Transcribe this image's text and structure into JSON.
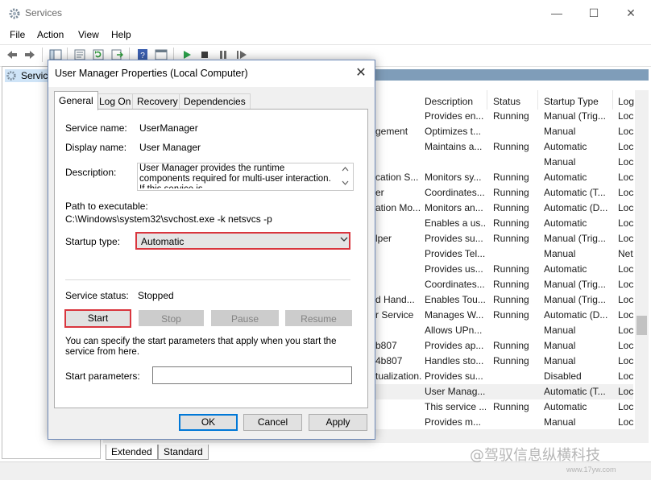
{
  "window": {
    "title": "Services",
    "menus": [
      "File",
      "Action",
      "View",
      "Help"
    ],
    "tree_node": "Services",
    "controls": {
      "minimize": "—",
      "maximize": "☐",
      "close": "✕"
    }
  },
  "list": {
    "columns": [
      "Description",
      "Status",
      "Startup Type",
      "Log"
    ],
    "rows": [
      {
        "name": "",
        "description": "Provides en...",
        "status": "Running",
        "startup": "Manual (Trig...",
        "log": "Loc"
      },
      {
        "name": "gement",
        "description": "Optimizes t...",
        "status": "",
        "startup": "Manual",
        "log": "Loc"
      },
      {
        "name": "",
        "description": "Maintains a...",
        "status": "Running",
        "startup": "Automatic",
        "log": "Loc"
      },
      {
        "name": "",
        "description": "",
        "status": "",
        "startup": "Manual",
        "log": "Loc"
      },
      {
        "name": "cation S...",
        "description": "Monitors sy...",
        "status": "Running",
        "startup": "Automatic",
        "log": "Loc"
      },
      {
        "name": "er",
        "description": "Coordinates...",
        "status": "Running",
        "startup": "Automatic (T...",
        "log": "Loc"
      },
      {
        "name": "ation Mo...",
        "description": "Monitors an...",
        "status": "Running",
        "startup": "Automatic (D...",
        "log": "Loc"
      },
      {
        "name": "",
        "description": "Enables a us...",
        "status": "Running",
        "startup": "Automatic",
        "log": "Loc"
      },
      {
        "name": "lper",
        "description": "Provides su...",
        "status": "Running",
        "startup": "Manual (Trig...",
        "log": "Loc"
      },
      {
        "name": "",
        "description": "Provides Tel...",
        "status": "",
        "startup": "Manual",
        "log": "Net"
      },
      {
        "name": "",
        "description": "Provides us...",
        "status": "Running",
        "startup": "Automatic",
        "log": "Loc"
      },
      {
        "name": "",
        "description": "Coordinates...",
        "status": "Running",
        "startup": "Manual (Trig...",
        "log": "Loc"
      },
      {
        "name": "d Hand...",
        "description": "Enables Tou...",
        "status": "Running",
        "startup": "Manual (Trig...",
        "log": "Loc"
      },
      {
        "name": "r Service",
        "description": "Manages W...",
        "status": "Running",
        "startup": "Automatic (D...",
        "log": "Loc"
      },
      {
        "name": "",
        "description": "Allows UPn...",
        "status": "",
        "startup": "Manual",
        "log": "Loc"
      },
      {
        "name": "b807",
        "description": "Provides ap...",
        "status": "Running",
        "startup": "Manual",
        "log": "Loc"
      },
      {
        "name": "4b807",
        "description": "Handles sto...",
        "status": "Running",
        "startup": "Manual",
        "log": "Loc"
      },
      {
        "name": "tualization...",
        "description": "Provides su...",
        "status": "",
        "startup": "Disabled",
        "log": "Loc"
      },
      {
        "name": "",
        "description": "User Manag...",
        "status": "",
        "startup": "Automatic (T...",
        "log": "Loc"
      },
      {
        "name": "",
        "description": "This service ...",
        "status": "Running",
        "startup": "Automatic",
        "log": "Loc"
      },
      {
        "name": "",
        "description": "Provides m...",
        "status": "",
        "startup": "Manual",
        "log": "Loc"
      }
    ],
    "selected_row": 18
  },
  "bottom_tabs": [
    "Extended",
    "Standard"
  ],
  "watermark": "@驾驭信息纵横科技",
  "watermark_url": "www.17yw.com",
  "dialog": {
    "title": "User Manager Properties (Local Computer)",
    "close": "✕",
    "tabs": [
      "General",
      "Log On",
      "Recovery",
      "Dependencies"
    ],
    "service_name_label": "Service name:",
    "service_name": "UserManager",
    "display_name_label": "Display name:",
    "display_name": "User Manager",
    "description_label": "Description:",
    "description": "User Manager provides the runtime components required for multi-user interaction.  If this service is",
    "path_label": "Path to executable:",
    "path": "C:\\Windows\\system32\\svchost.exe -k netsvcs -p",
    "startup_type_label": "Startup type:",
    "startup_type": "Automatic",
    "status_label": "Service status:",
    "status": "Stopped",
    "buttons": {
      "start": "Start",
      "stop": "Stop",
      "pause": "Pause",
      "resume": "Resume"
    },
    "hint": "You can specify the start parameters that apply when you start the service from here.",
    "params_label": "Start parameters:",
    "params_value": "",
    "ok": "OK",
    "cancel": "Cancel",
    "apply": "Apply"
  },
  "colors": {
    "highlight_red": "#d9363e",
    "accent_blue": "#0078d7"
  }
}
